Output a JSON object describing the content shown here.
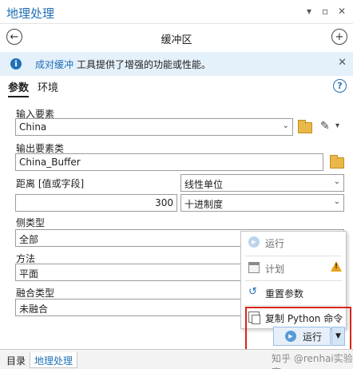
{
  "pane": {
    "title": "地理处理",
    "tool_title": "缓冲区"
  },
  "info": {
    "link": "成对缓冲",
    "message": "工具提供了增强的功能或性能。"
  },
  "tabs": [
    "参数",
    "环境"
  ],
  "params": {
    "input_label": "输入要素",
    "input_value": "China",
    "output_label": "输出要素类",
    "output_value": "China_Buffer",
    "distance_label": "距离 [值或字段]",
    "distance_type": "线性单位",
    "distance_value": "300",
    "distance_unit": "十进制度",
    "side_label": "侧类型",
    "side_value": "全部",
    "method_label": "方法",
    "method_value": "平面",
    "dissolve_label": "融合类型",
    "dissolve_value": "未融合"
  },
  "run_menu": {
    "items": [
      "运行",
      "计划",
      "重置参数",
      "复制 Python 命令"
    ]
  },
  "run_button": "运行",
  "bottom_tabs": [
    "目录",
    "地理处理"
  ],
  "watermark": "知乎 @renhai实验室",
  "colors": {
    "accent": "#2171b5",
    "info_bg": "#e4f0fa",
    "highlight": "#d9251c"
  }
}
